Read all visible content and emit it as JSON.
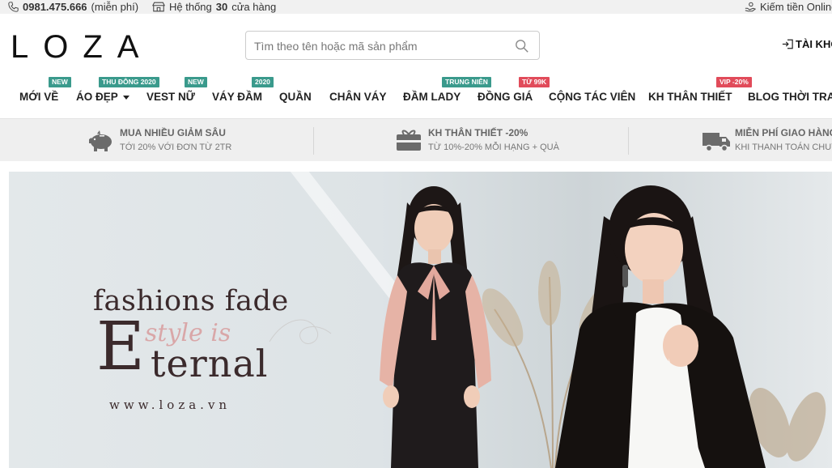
{
  "topbar": {
    "phone": "0981.475.666",
    "phone_note": "(miễn phí)",
    "stores_prefix": "Hệ thống",
    "stores_count": "30",
    "stores_suffix": "cửa hàng",
    "earn": "Kiếm tiền Online"
  },
  "header": {
    "logo": "LOZA",
    "search_placeholder": "Tìm theo tên hoặc mã sản phẩm",
    "account": "TÀI KHO"
  },
  "nav": {
    "items": [
      {
        "label": "MỚI VỀ",
        "badge": "NEW",
        "badge_color": "#3a9a8c"
      },
      {
        "label": "ÁO ĐẸP",
        "badge": "THU ĐÔNG 2020",
        "badge_color": "#3a9a8c",
        "dropdown": true
      },
      {
        "label": "VEST NỮ",
        "badge": "NEW",
        "badge_color": "#3a9a8c"
      },
      {
        "label": "VÁY ĐẦM",
        "badge": "2020",
        "badge_color": "#3a9a8c"
      },
      {
        "label": "QUẦN"
      },
      {
        "label": "CHÂN VÁY"
      },
      {
        "label": "ĐẦM LADY",
        "badge": "TRUNG NIÊN",
        "badge_color": "#3a9a8c"
      },
      {
        "label": "ĐỒNG GIÁ",
        "badge": "TỪ 99K",
        "badge_color": "#e14b5a"
      },
      {
        "label": "CỘNG TÁC VIÊN"
      },
      {
        "label": "KH THÂN THIẾT",
        "badge": "VIP -20%",
        "badge_color": "#e14b5a"
      },
      {
        "label": "BLOG THỜI TRAN"
      }
    ]
  },
  "promo": [
    {
      "title": "MUA NHIỀU GIẢM SÂU",
      "sub": "TỚI 20% VỚI ĐƠN TỪ 2TR",
      "icon": "piggy-bank-icon"
    },
    {
      "title": "KH THÂN THIẾT -20%",
      "sub": "TỪ 10%-20% MỖI HẠNG + QUÀ",
      "icon": "gift-card-icon"
    },
    {
      "title": "MIỄN PHÍ GIAO HÀNG",
      "sub": "KHI THANH TOÁN CHUYỂ",
      "icon": "delivery-truck-icon"
    }
  ],
  "hero": {
    "line1": "fashions fade",
    "style_is": "style is",
    "big_letter": "E",
    "ternal": "ternal",
    "url": "www.loza.vn"
  },
  "colors": {
    "badge_teal": "#3a9a8c",
    "badge_red": "#e14b5a",
    "slogan": "#3b2a2c",
    "slogan_accent": "#d9a7a8"
  }
}
